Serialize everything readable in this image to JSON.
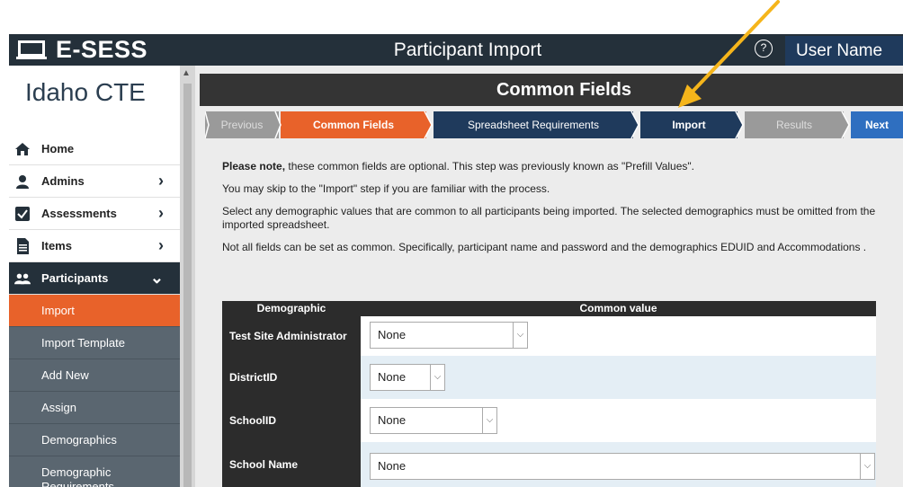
{
  "header": {
    "brand": "E-SESS",
    "title": "Participant Import",
    "help_icon": "?",
    "user": "User Name"
  },
  "sidebar": {
    "org": "Idaho CTE",
    "items": [
      {
        "label": "Home",
        "icon": "home-icon"
      },
      {
        "label": "Admins",
        "icon": "person-icon"
      },
      {
        "label": "Assessments",
        "icon": "checkbox-icon"
      },
      {
        "label": "Items",
        "icon": "list-icon"
      },
      {
        "label": "Participants",
        "icon": "people-icon"
      }
    ],
    "sub_items": [
      {
        "label": "Import"
      },
      {
        "label": "Import Template"
      },
      {
        "label": "Add New"
      },
      {
        "label": "Assign"
      },
      {
        "label": "Demographics"
      },
      {
        "label": "Demographic Requirements"
      }
    ]
  },
  "main": {
    "section_title": "Common Fields",
    "steps": [
      {
        "label": "Previous"
      },
      {
        "label": "Common Fields"
      },
      {
        "label": "Spreadsheet Requirements"
      },
      {
        "label": "Import"
      },
      {
        "label": "Results"
      },
      {
        "label": "Next"
      }
    ],
    "notes": {
      "p1_bold": "Please note,",
      "p1_rest": " these common fields are optional. This step was previously known as \"Prefill Values\".",
      "p2": "You may skip to the \"Import\" step if you are familiar with the process.",
      "p3": "Select any demographic values that are common to all participants being imported. The selected demographics must be omitted from the imported spreadsheet.",
      "p4": "Not all fields can be set as common. Specifically, participant name and password and the demographics EDUID and Accommodations ."
    },
    "table": {
      "headers": [
        "Demographic",
        "Common value"
      ],
      "rows": [
        {
          "label": "Test Site Administrator",
          "value": "None"
        },
        {
          "label": "DistrictID",
          "value": "None"
        },
        {
          "label": "SchoolID",
          "value": "None"
        },
        {
          "label": "School Name",
          "value": "None"
        }
      ]
    }
  },
  "colors": {
    "topbar": "#24303a",
    "accent_orange": "#e8622a",
    "step_blue": "#1f3a5c",
    "step_grey": "#9a9a9a",
    "annotation_arrow": "#f5b51b"
  }
}
